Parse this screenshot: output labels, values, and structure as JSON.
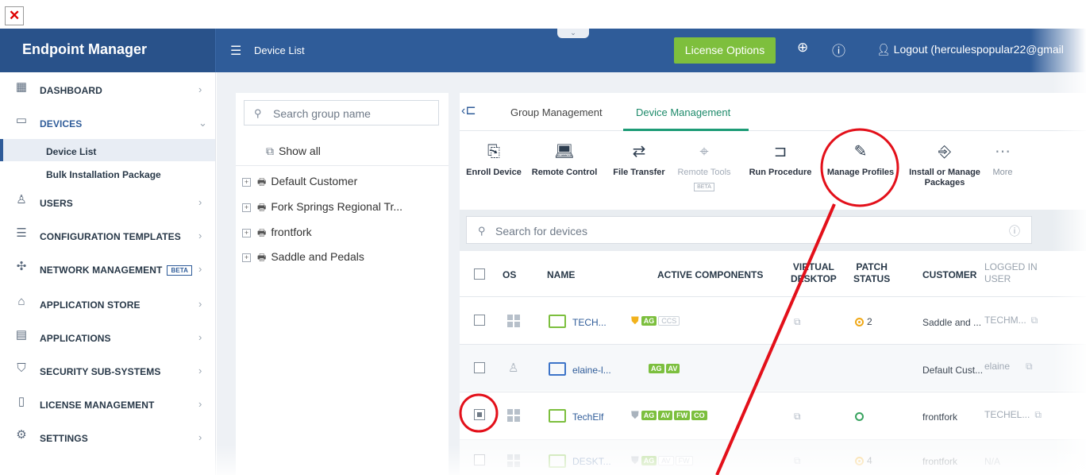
{
  "header": {
    "brand": "Endpoint Manager",
    "page_title": "Device List",
    "license_button": "License Options",
    "logout": "Logout (herculespopular22@gmail"
  },
  "sidebar": {
    "items": [
      {
        "label": "DASHBOARD",
        "icon": "dashboard-icon"
      },
      {
        "label": "DEVICES",
        "icon": "devices-icon"
      },
      {
        "label": "USERS",
        "icon": "user-icon"
      },
      {
        "label": "CONFIGURATION TEMPLATES",
        "icon": "templates-icon"
      },
      {
        "label": "NETWORK MANAGEMENT",
        "icon": "network-icon",
        "badge": "BETA"
      },
      {
        "label": "APPLICATION STORE",
        "icon": "store-icon"
      },
      {
        "label": "APPLICATIONS",
        "icon": "applications-icon"
      },
      {
        "label": "SECURITY SUB-SYSTEMS",
        "icon": "shield-icon"
      },
      {
        "label": "LICENSE MANAGEMENT",
        "icon": "license-icon"
      },
      {
        "label": "SETTINGS",
        "icon": "gear-icon"
      }
    ],
    "sub_items": [
      {
        "label": "Device List"
      },
      {
        "label": "Bulk Installation Package"
      }
    ]
  },
  "groups": {
    "search_placeholder": "Search group name",
    "show_all": "Show all",
    "items": [
      {
        "label": "Default Customer"
      },
      {
        "label": "Fork Springs Regional Tr..."
      },
      {
        "label": "frontfork"
      },
      {
        "label": "Saddle and Pedals"
      }
    ]
  },
  "tabs": [
    {
      "label": "Group Management"
    },
    {
      "label": "Device Management"
    }
  ],
  "toolbar": {
    "enroll": "Enroll Device",
    "remote_control": "Remote Control",
    "file_transfer": "File Transfer",
    "remote_tools": "Remote Tools",
    "remote_tools_badge": "BETA",
    "run_procedure": "Run Procedure",
    "manage_profiles": "Manage Profiles",
    "install_manage_1": "Install or Manage",
    "install_manage_2": "Packages",
    "more": "More"
  },
  "device_search": {
    "placeholder": "Search for devices"
  },
  "table": {
    "headers": {
      "os": "OS",
      "name": "NAME",
      "active_components": "ACTIVE COMPONENTS",
      "virtual_1": "VIRTUAL",
      "virtual_2": "DESKTOP",
      "patch_1": "PATCH",
      "patch_2": "STATUS",
      "customer": "CUSTOMER",
      "logged_1": "LOGGED IN",
      "logged_2": "USER"
    },
    "rows": [
      {
        "name": "TECH...",
        "badges": [
          "AG",
          "CCS"
        ],
        "patch": "2",
        "customer": "Saddle and ...",
        "logged_user": "TECHM..."
      },
      {
        "name": "elaine-l...",
        "badges": [
          "AG",
          "AV"
        ],
        "patch": "",
        "customer": "Default Cust...",
        "logged_user": "elaine"
      },
      {
        "name": "TechElf",
        "badges": [
          "AG",
          "AV",
          "FW",
          "CO"
        ],
        "patch": "",
        "customer": "frontfork",
        "logged_user": "TECHEL..."
      },
      {
        "name": "DESKT...",
        "badges": [
          "AG",
          "AV",
          "FW"
        ],
        "patch": "4",
        "customer": "frontfork",
        "logged_user": "N/A"
      }
    ]
  },
  "colors": {
    "header_blue": "#2f5c99",
    "brand_blue": "#29528a",
    "license_green": "#7ebf3d",
    "active_tab": "#1d9c76",
    "badge_green": "#7cbf3e",
    "annotation_red": "#e3101a"
  }
}
